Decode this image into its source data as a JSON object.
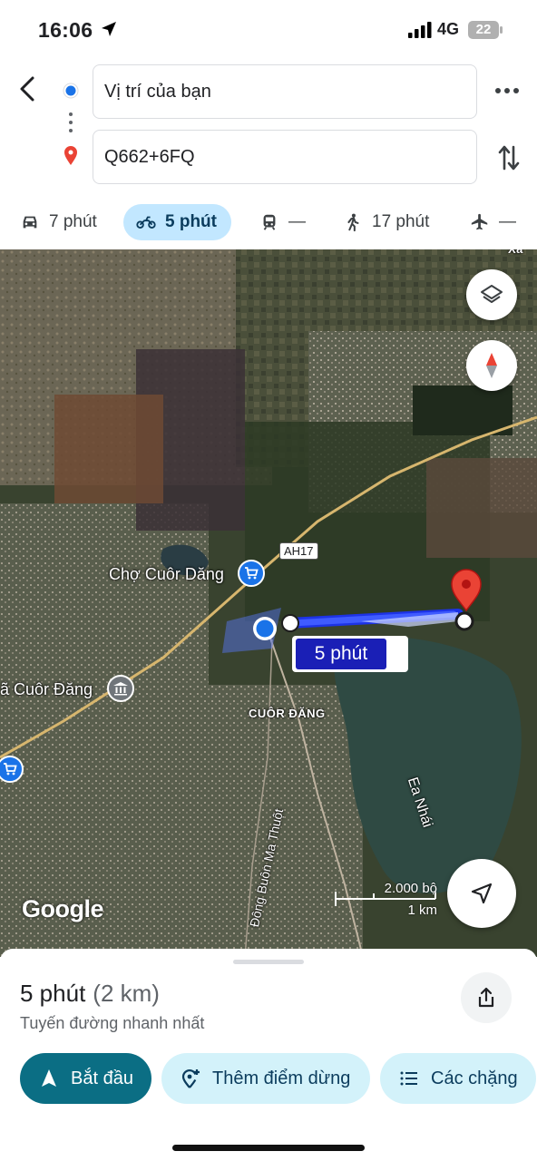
{
  "status_bar": {
    "time": "16:06",
    "network": "4G",
    "battery": "22"
  },
  "search": {
    "from": "Vị trí của bạn",
    "to": "Q662+6FQ"
  },
  "modes": [
    {
      "name": "car",
      "label": "7 phút",
      "active": false
    },
    {
      "name": "motorbike",
      "label": "5 phút",
      "active": true
    },
    {
      "name": "transit",
      "label": "—",
      "active": false
    },
    {
      "name": "walk",
      "label": "17 phút",
      "active": false
    },
    {
      "name": "flight",
      "label": "—",
      "active": false
    }
  ],
  "map": {
    "labels": {
      "market": "Chợ Cuôr Dăng",
      "commune": "ã Cuôr Đăng",
      "town": "CUÔR ĐĂNG",
      "lake": "Ea Nhái",
      "road": "Đông Buôn Ma Thuột",
      "highway": "AH17",
      "corner": "Xã"
    },
    "route_label": "5 phút",
    "logo": "Google",
    "scale": {
      "imperial": "2.000 bộ",
      "metric": "1 km"
    },
    "colors": {
      "route": "#1a3cff",
      "pin": "#ea4335",
      "user": "#1a73e8"
    }
  },
  "sheet": {
    "duration": "5 phút",
    "distance": "(2 km)",
    "subtitle": "Tuyến đường nhanh nhất",
    "buttons": {
      "start": "Bắt đầu",
      "add_stop": "Thêm điểm dừng",
      "steps": "Các chặng"
    }
  }
}
